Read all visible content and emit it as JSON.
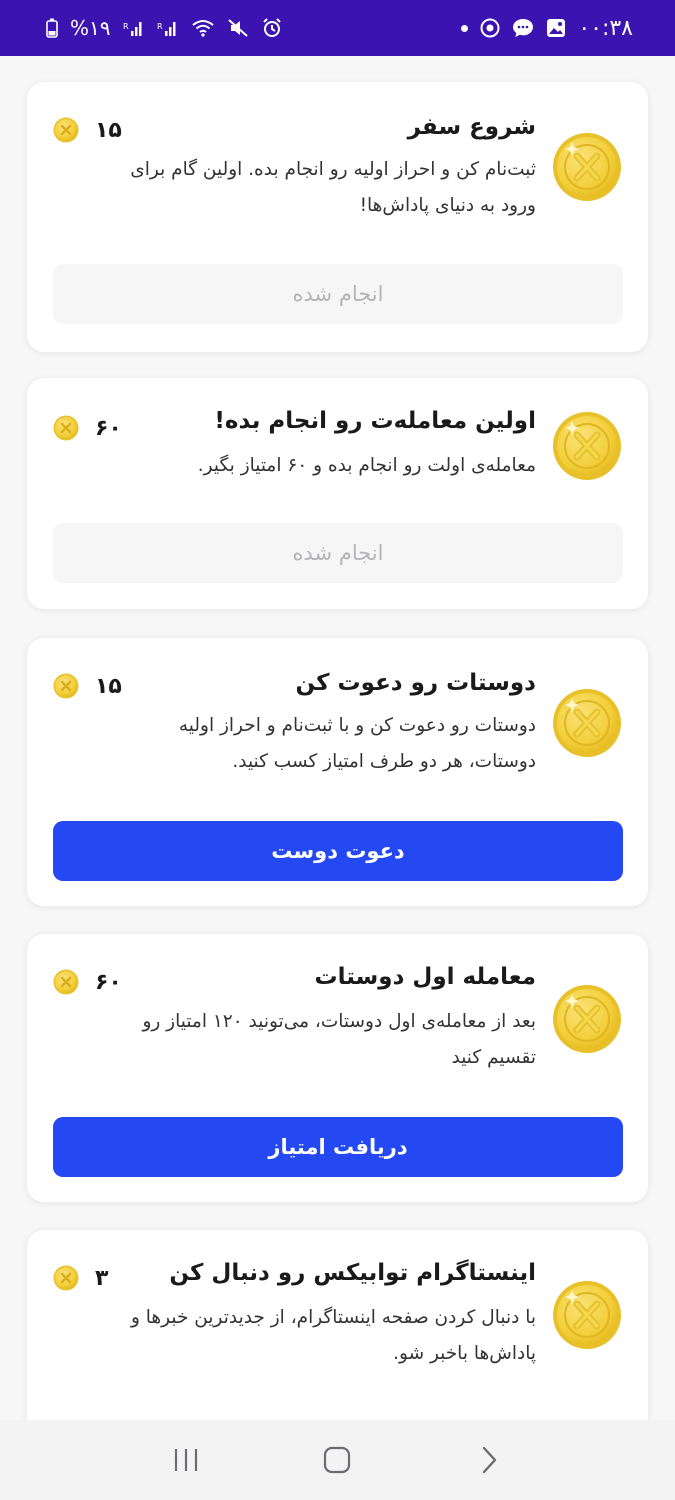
{
  "status_bar": {
    "time": "۰۰:۳۸",
    "battery": "%۱۹"
  },
  "tasks": [
    {
      "title": "شروع سفر",
      "description": "ثبت‌نام کن و احراز اولیه رو انجام بده. اولین گام برای ورود به دنیای پاداش‌ها!",
      "reward": "۱۵",
      "button_label": "انجام شده",
      "button_state": "done"
    },
    {
      "title": "اولین معامله‌ت رو انجام بده!",
      "description": "معامله‌ی اولت رو انجام بده و ۶۰ امتیاز بگیر.",
      "reward": "۶۰",
      "button_label": "انجام شده",
      "button_state": "done"
    },
    {
      "title": "دوستات رو دعوت کن",
      "description": "دوستات رو دعوت کن و با ثبت‌نام و احراز اولیه دوستات، هر دو طرف امتیاز کسب کنید.",
      "reward": "۱۵",
      "button_label": "دعوت دوست",
      "button_state": "active"
    },
    {
      "title": "معامله اول دوستات",
      "description": "بعد از معامله‌ی اول دوستات، می‌تونید ۱۲۰ امتیاز رو تقسیم کنید",
      "reward": "۶۰",
      "button_label": "دریافت امتیاز",
      "button_state": "active"
    },
    {
      "title": "اینستاگرام توابیکس رو دنبال کن",
      "description": "با دنبال کردن صفحه اینستاگرام، از جدیدترین خبرها و پاداش‌ها باخبر شو.",
      "reward": "۳"
    }
  ],
  "colors": {
    "status_bar_bg": "#3b13b0",
    "primary_button": "#2448f2",
    "done_button_bg": "#f6f6f7",
    "coin_gold": "#f2cf3a"
  },
  "icons": {
    "coin": "coin-icon",
    "nav_recents": "recents-icon",
    "nav_home": "home-icon",
    "nav_back": "back-icon"
  }
}
